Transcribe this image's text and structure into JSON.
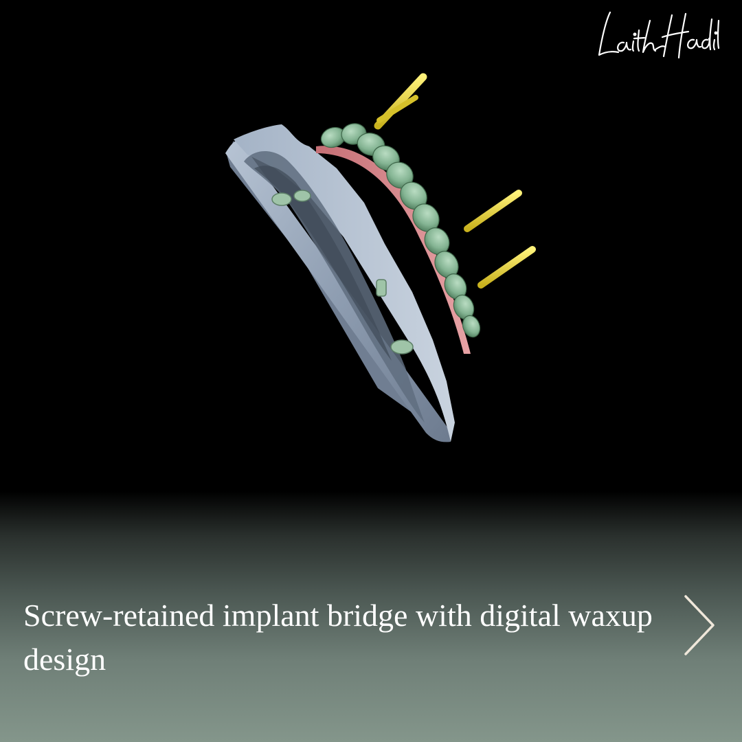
{
  "brand": {
    "signature_text": "LaithHadid"
  },
  "caption": {
    "text": "Screw-retained implant bridge with digital waxup design"
  },
  "navigation": {
    "next_icon": "chevron-right-icon"
  },
  "colors": {
    "background_top": "#000000",
    "background_bottom": "#84968b",
    "caption_text": "#ffffff",
    "teeth": "#8db99a",
    "gingiva": "#d98a8e",
    "model_base": "#9aa9bd",
    "screw_channels": "#e6d33a",
    "arrow": "#efe7da"
  }
}
